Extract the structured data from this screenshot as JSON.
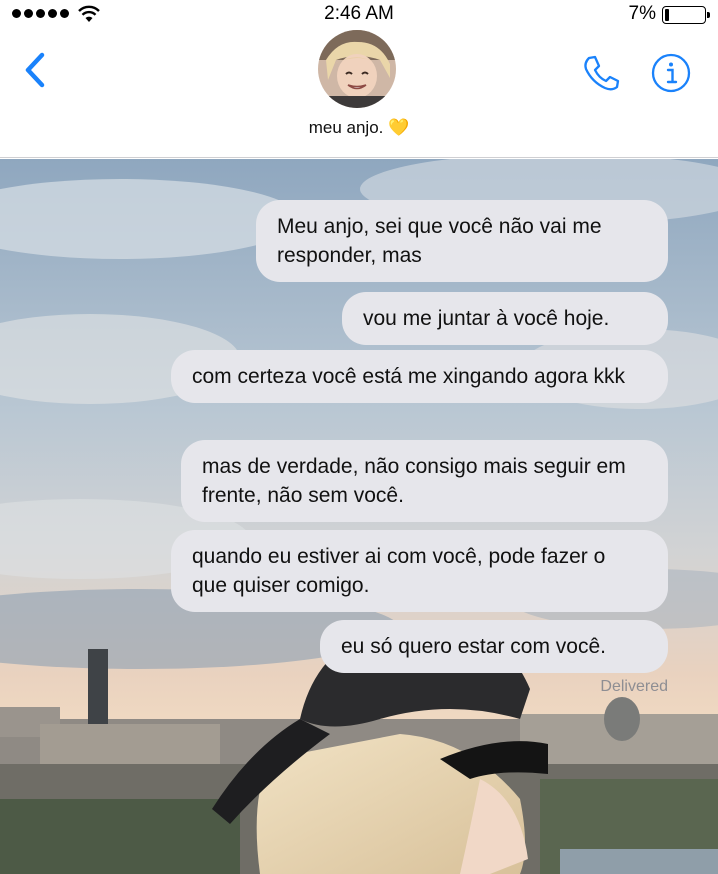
{
  "status": {
    "time": "2:46 AM",
    "battery": "7%",
    "battery_level": 0.07
  },
  "header": {
    "contact_name": "meu anjo. 💛",
    "back_icon": "chevron-left-icon",
    "call_icon": "phone-icon",
    "info_icon": "info-icon",
    "accent": "#1a82fb"
  },
  "messages": [
    "Meu anjo, sei que você não vai me responder, mas",
    "vou me juntar à você hoje.",
    "com certeza você está me xingando agora kkk",
    "mas de verdade, não consigo mais seguir em frente, não sem você.",
    "quando eu estiver ai com você, pode fazer o que quiser comigo.",
    "eu só quero estar com você."
  ],
  "delivered_label": "Delivered",
  "bubble_color": "#e6e6eb"
}
